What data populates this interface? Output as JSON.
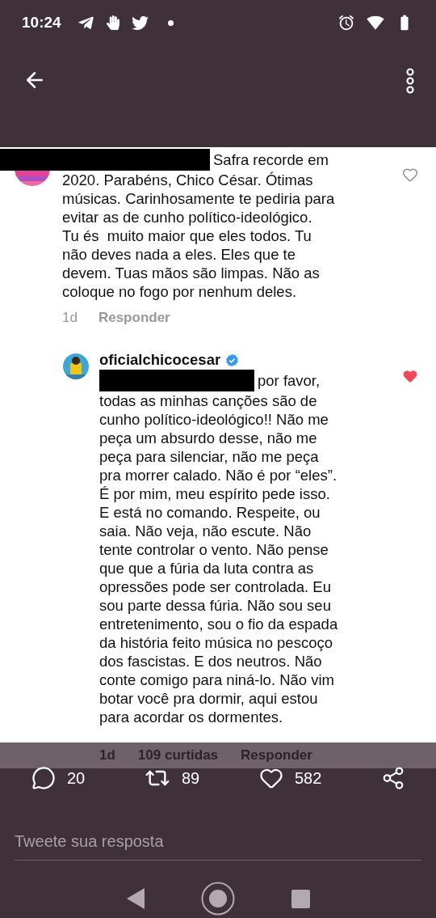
{
  "status_bar": {
    "time": "10:24"
  },
  "post_image": {
    "comments": [
      {
        "redacted_prefix": true,
        "text": "Safra recorde em\n2020. Parabéns, Chico César. Ótimas\nmúsicas. Carinhosamente te pediria para\nevitar as de cunho político-ideológico.\nTu és  muito maior que eles todos. Tu\nnão deves nada a eles. Eles que te\ndevem. Tuas mãos são limpas. Não as\ncoloque no fogo por nenhum deles.",
        "liked": false,
        "meta": {
          "age": "1d",
          "reply": "Responder"
        }
      },
      {
        "username": "oficialchicocesar",
        "verified": true,
        "redacted_prefix": true,
        "text": "por favor,\ntodas as minhas canções são de\ncunho político-ideológico!! Não me\npeça um absurdo desse, não me\npeça para silenciar, não me peça\npra morrer calado. Não é por “eles”.\nÉ por mim, meu espírito pede isso.\nE está no comando. Respeite, ou\nsaia. Não veja, não escute. Não\ntente controlar o vento. Não pense\nque que a fúria da luta contra as\nopressões pode ser controlada. Eu\nsou parte dessa fúria. Não sou seu\nentretenimento, sou o fio da espada\nda história feito música no pescoço\ndos fascistas. E dos neutros. Não\nconte comigo para niná-lo. Não vim\nbotar você pra dormir, aqui estou\npara acordar os dormentes.",
        "liked": true
      }
    ],
    "footer_meta": {
      "age": "1d",
      "likes": "109 curtidas",
      "reply": "Responder"
    }
  },
  "actions": [
    {
      "kind": "reply",
      "count": "20"
    },
    {
      "kind": "retweet",
      "count": "89"
    },
    {
      "kind": "like",
      "count": "582"
    },
    {
      "kind": "share"
    }
  ],
  "reply_field": {
    "placeholder": "Tweete sua resposta"
  }
}
